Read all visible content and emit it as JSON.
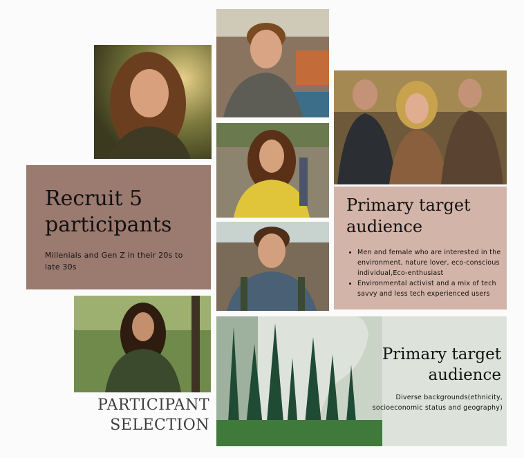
{
  "recruit_card": {
    "title": "Recruit 5 participants",
    "subtitle": "Millenials and Gen Z in their 20s to late 30s"
  },
  "target_card": {
    "title": "Primary target audience",
    "bullets": [
      "Men and female who are interested in the environment, nature lover, eco-conscious individual,Eco-enthusiast",
      "Environmental activist and a mix of tech savvy and less tech experienced users"
    ]
  },
  "forest_card": {
    "title": "Primary target audience",
    "description": "Diverse backgrounds(ethnicity, socioeconomic status and geography)"
  },
  "selection_title": "PARTICIPANT SELECTION",
  "colors": {
    "recruit_bg": "#9b7a6f",
    "target_bg": "#d3b4a8",
    "forest_bg": "#dde3db",
    "page_bg": "#fbfbfb"
  }
}
